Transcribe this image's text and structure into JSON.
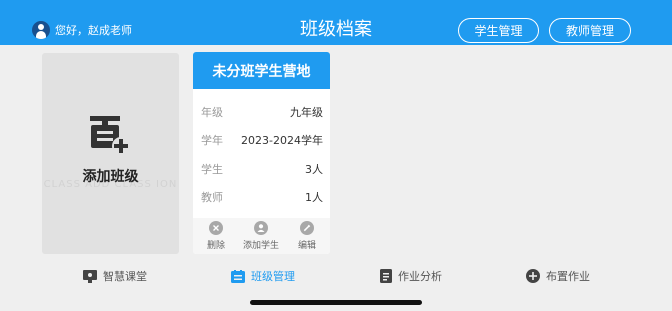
{
  "header": {
    "greeting": "您好，赵成老师",
    "title": "班级档案",
    "buttons": [
      "学生管理",
      "教师管理"
    ]
  },
  "add_card": {
    "label": "添加班级",
    "watermark": "CLASS ADD CLASS ION"
  },
  "class_card": {
    "name": "未分班学生营地",
    "rows": [
      {
        "label": "年级",
        "value": "九年级"
      },
      {
        "label": "学年",
        "value": "2023-2024学年"
      },
      {
        "label": "学生",
        "value": "3人"
      },
      {
        "label": "教师",
        "value": "1人"
      }
    ],
    "actions": [
      "删除",
      "添加学生",
      "编辑"
    ]
  },
  "tabs": [
    {
      "label": "智慧课堂",
      "icon": "smart-classroom-icon"
    },
    {
      "label": "班级管理",
      "icon": "class-management-icon",
      "active": true
    },
    {
      "label": "作业分析",
      "icon": "homework-analysis-icon"
    },
    {
      "label": "布置作业",
      "icon": "assign-homework-icon"
    }
  ],
  "colors": {
    "accent": "#1f9bf0",
    "background": "#efefef",
    "card_grey": "#e1e1e1"
  }
}
